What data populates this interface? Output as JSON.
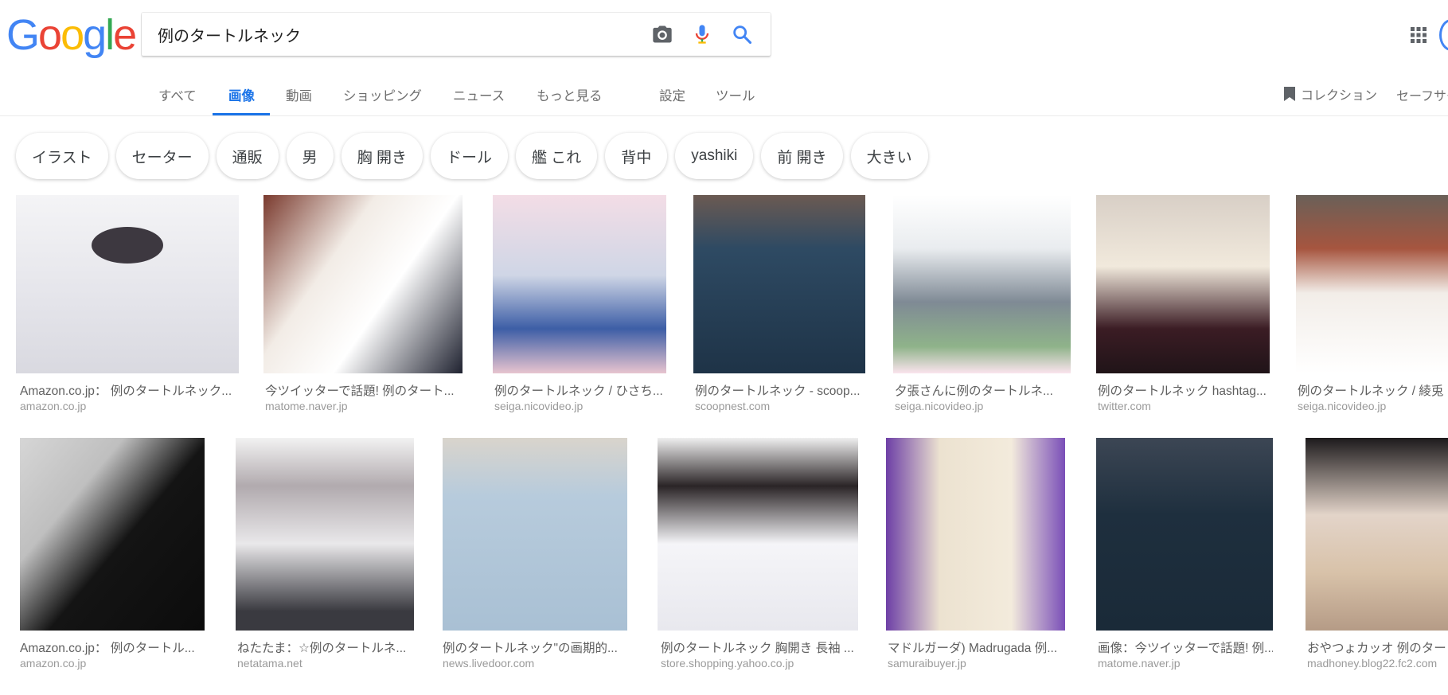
{
  "search": {
    "query": "例のタートルネック"
  },
  "logo": {
    "letters": [
      "G",
      "o",
      "o",
      "g",
      "l",
      "e"
    ],
    "colors": [
      "#4285f4",
      "#ea4335",
      "#fbbc05",
      "#4285f4",
      "#34a853",
      "#ea4335"
    ]
  },
  "icons": {
    "camera": "camera-icon",
    "mic": "microphone-icon",
    "search": "search-icon",
    "apps": "apps-grid-icon",
    "bookmark": "bookmark-icon"
  },
  "nav": {
    "items": [
      {
        "label": "すべて",
        "active": false
      },
      {
        "label": "画像",
        "active": true
      },
      {
        "label": "動画",
        "active": false
      },
      {
        "label": "ショッピング",
        "active": false
      },
      {
        "label": "ニュース",
        "active": false
      },
      {
        "label": "もっと見る",
        "active": false
      },
      {
        "label": "設定",
        "active": false
      },
      {
        "label": "ツール",
        "active": false
      }
    ],
    "collection": "コレクション",
    "safesearch": "セーフサーチ"
  },
  "chips": [
    "イラスト",
    "セーター",
    "通販",
    "男",
    "胸 開き",
    "ドール",
    "艦 これ",
    "背中",
    "yashiki",
    "前 開き",
    "大きい"
  ],
  "results": {
    "row1": [
      {
        "title": "Amazon.co.jp： 例のタートルネック...",
        "domain": "amazon.co.jp"
      },
      {
        "title": "今ツイッターで話題! 例のタート...",
        "domain": "matome.naver.jp"
      },
      {
        "title": "例のタートルネック / ひさち...",
        "domain": "seiga.nicovideo.jp"
      },
      {
        "title": "例のタートルネック - scoop...",
        "domain": "scoopnest.com"
      },
      {
        "title": "夕張さんに例のタートルネ...",
        "domain": "seiga.nicovideo.jp"
      },
      {
        "title": "例のタートルネック hashtag...",
        "domain": "twitter.com"
      },
      {
        "title": "例のタートルネック / 綾兎",
        "domain": "seiga.nicovideo.jp"
      }
    ],
    "row2": [
      {
        "title": "Amazon.co.jp： 例のタートル...",
        "domain": "amazon.co.jp"
      },
      {
        "title": "ねたたま：☆例のタートルネ...",
        "domain": "netatama.net"
      },
      {
        "title": "例のタートルネック\"の画期的...",
        "domain": "news.livedoor.com"
      },
      {
        "title": "例のタートルネック 胸開き 長袖 ...",
        "domain": "store.shopping.yahoo.co.jp"
      },
      {
        "title": "マドルガーダ) Madrugada 例...",
        "domain": "samuraibuyer.jp"
      },
      {
        "title": "画像：今ツイッターで話題! 例...",
        "domain": "matome.naver.jp"
      },
      {
        "title": "おやつょカッオ 例のター",
        "domain": "madhoney.blog22.fc2.com"
      }
    ]
  }
}
